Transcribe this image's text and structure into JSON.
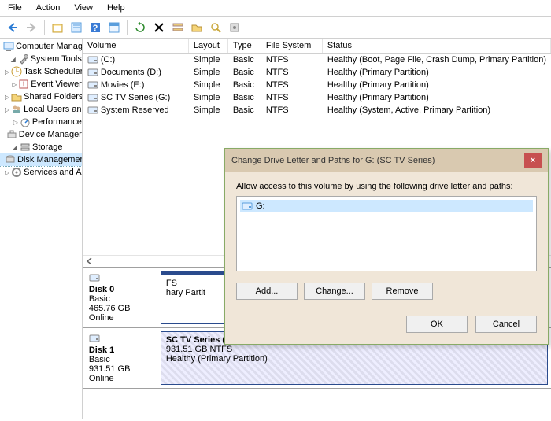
{
  "menubar": {
    "file": "File",
    "action": "Action",
    "view": "View",
    "help": "Help"
  },
  "tree": {
    "root": "Computer Management (Local",
    "system_tools": "System Tools",
    "task_scheduler": "Task Scheduler",
    "event_viewer": "Event Viewer",
    "shared_folders": "Shared Folders",
    "local_users": "Local Users and Groups",
    "performance": "Performance",
    "device_manager": "Device Manager",
    "storage": "Storage",
    "disk_management": "Disk Management",
    "services": "Services and Applications"
  },
  "volumes": {
    "headers": {
      "volume": "Volume",
      "layout": "Layout",
      "type": "Type",
      "fs": "File System",
      "status": "Status"
    },
    "rows": [
      {
        "volume": "(C:)",
        "layout": "Simple",
        "type": "Basic",
        "fs": "NTFS",
        "status": "Healthy (Boot, Page File, Crash Dump, Primary Partition)"
      },
      {
        "volume": "Documents (D:)",
        "layout": "Simple",
        "type": "Basic",
        "fs": "NTFS",
        "status": "Healthy (Primary Partition)"
      },
      {
        "volume": "Movies (E:)",
        "layout": "Simple",
        "type": "Basic",
        "fs": "NTFS",
        "status": "Healthy (Primary Partition)"
      },
      {
        "volume": "SC TV Series (G:)",
        "layout": "Simple",
        "type": "Basic",
        "fs": "NTFS",
        "status": "Healthy (Primary Partition)"
      },
      {
        "volume": "System Reserved",
        "layout": "Simple",
        "type": "Basic",
        "fs": "NTFS",
        "status": "Healthy (System, Active, Primary Partition)"
      }
    ]
  },
  "disks": [
    {
      "name": "Disk 0",
      "type": "Basic",
      "size": "465.76 GB",
      "state": "Online",
      "parts": [
        {
          "title": "",
          "sub1": "FS",
          "sub2": "hary Partit"
        }
      ]
    },
    {
      "name": "Disk 1",
      "type": "Basic",
      "size": "931.51 GB",
      "state": "Online",
      "parts": [
        {
          "title": "SC TV Series  (G:)",
          "sub1": "931.51 GB NTFS",
          "sub2": "Healthy (Primary Partition)"
        }
      ]
    }
  ],
  "dialog": {
    "title": "Change Drive Letter and Paths for G: (SC TV Series)",
    "instruction": "Allow access to this volume by using the following drive letter and paths:",
    "item": "G:",
    "add": "Add...",
    "change": "Change...",
    "remove": "Remove",
    "ok": "OK",
    "cancel": "Cancel"
  }
}
